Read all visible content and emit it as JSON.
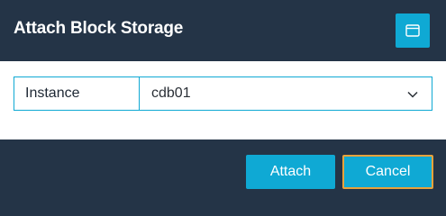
{
  "dialog": {
    "title": "Attach Block Storage",
    "header_icon": "window-icon"
  },
  "form": {
    "instance_label": "Instance",
    "instance_value": "cdb01"
  },
  "footer": {
    "attach_label": "Attach",
    "cancel_label": "Cancel"
  },
  "colors": {
    "background": "#243447",
    "accent": "#0fa9d4",
    "focus_outline": "#e8a23b"
  }
}
